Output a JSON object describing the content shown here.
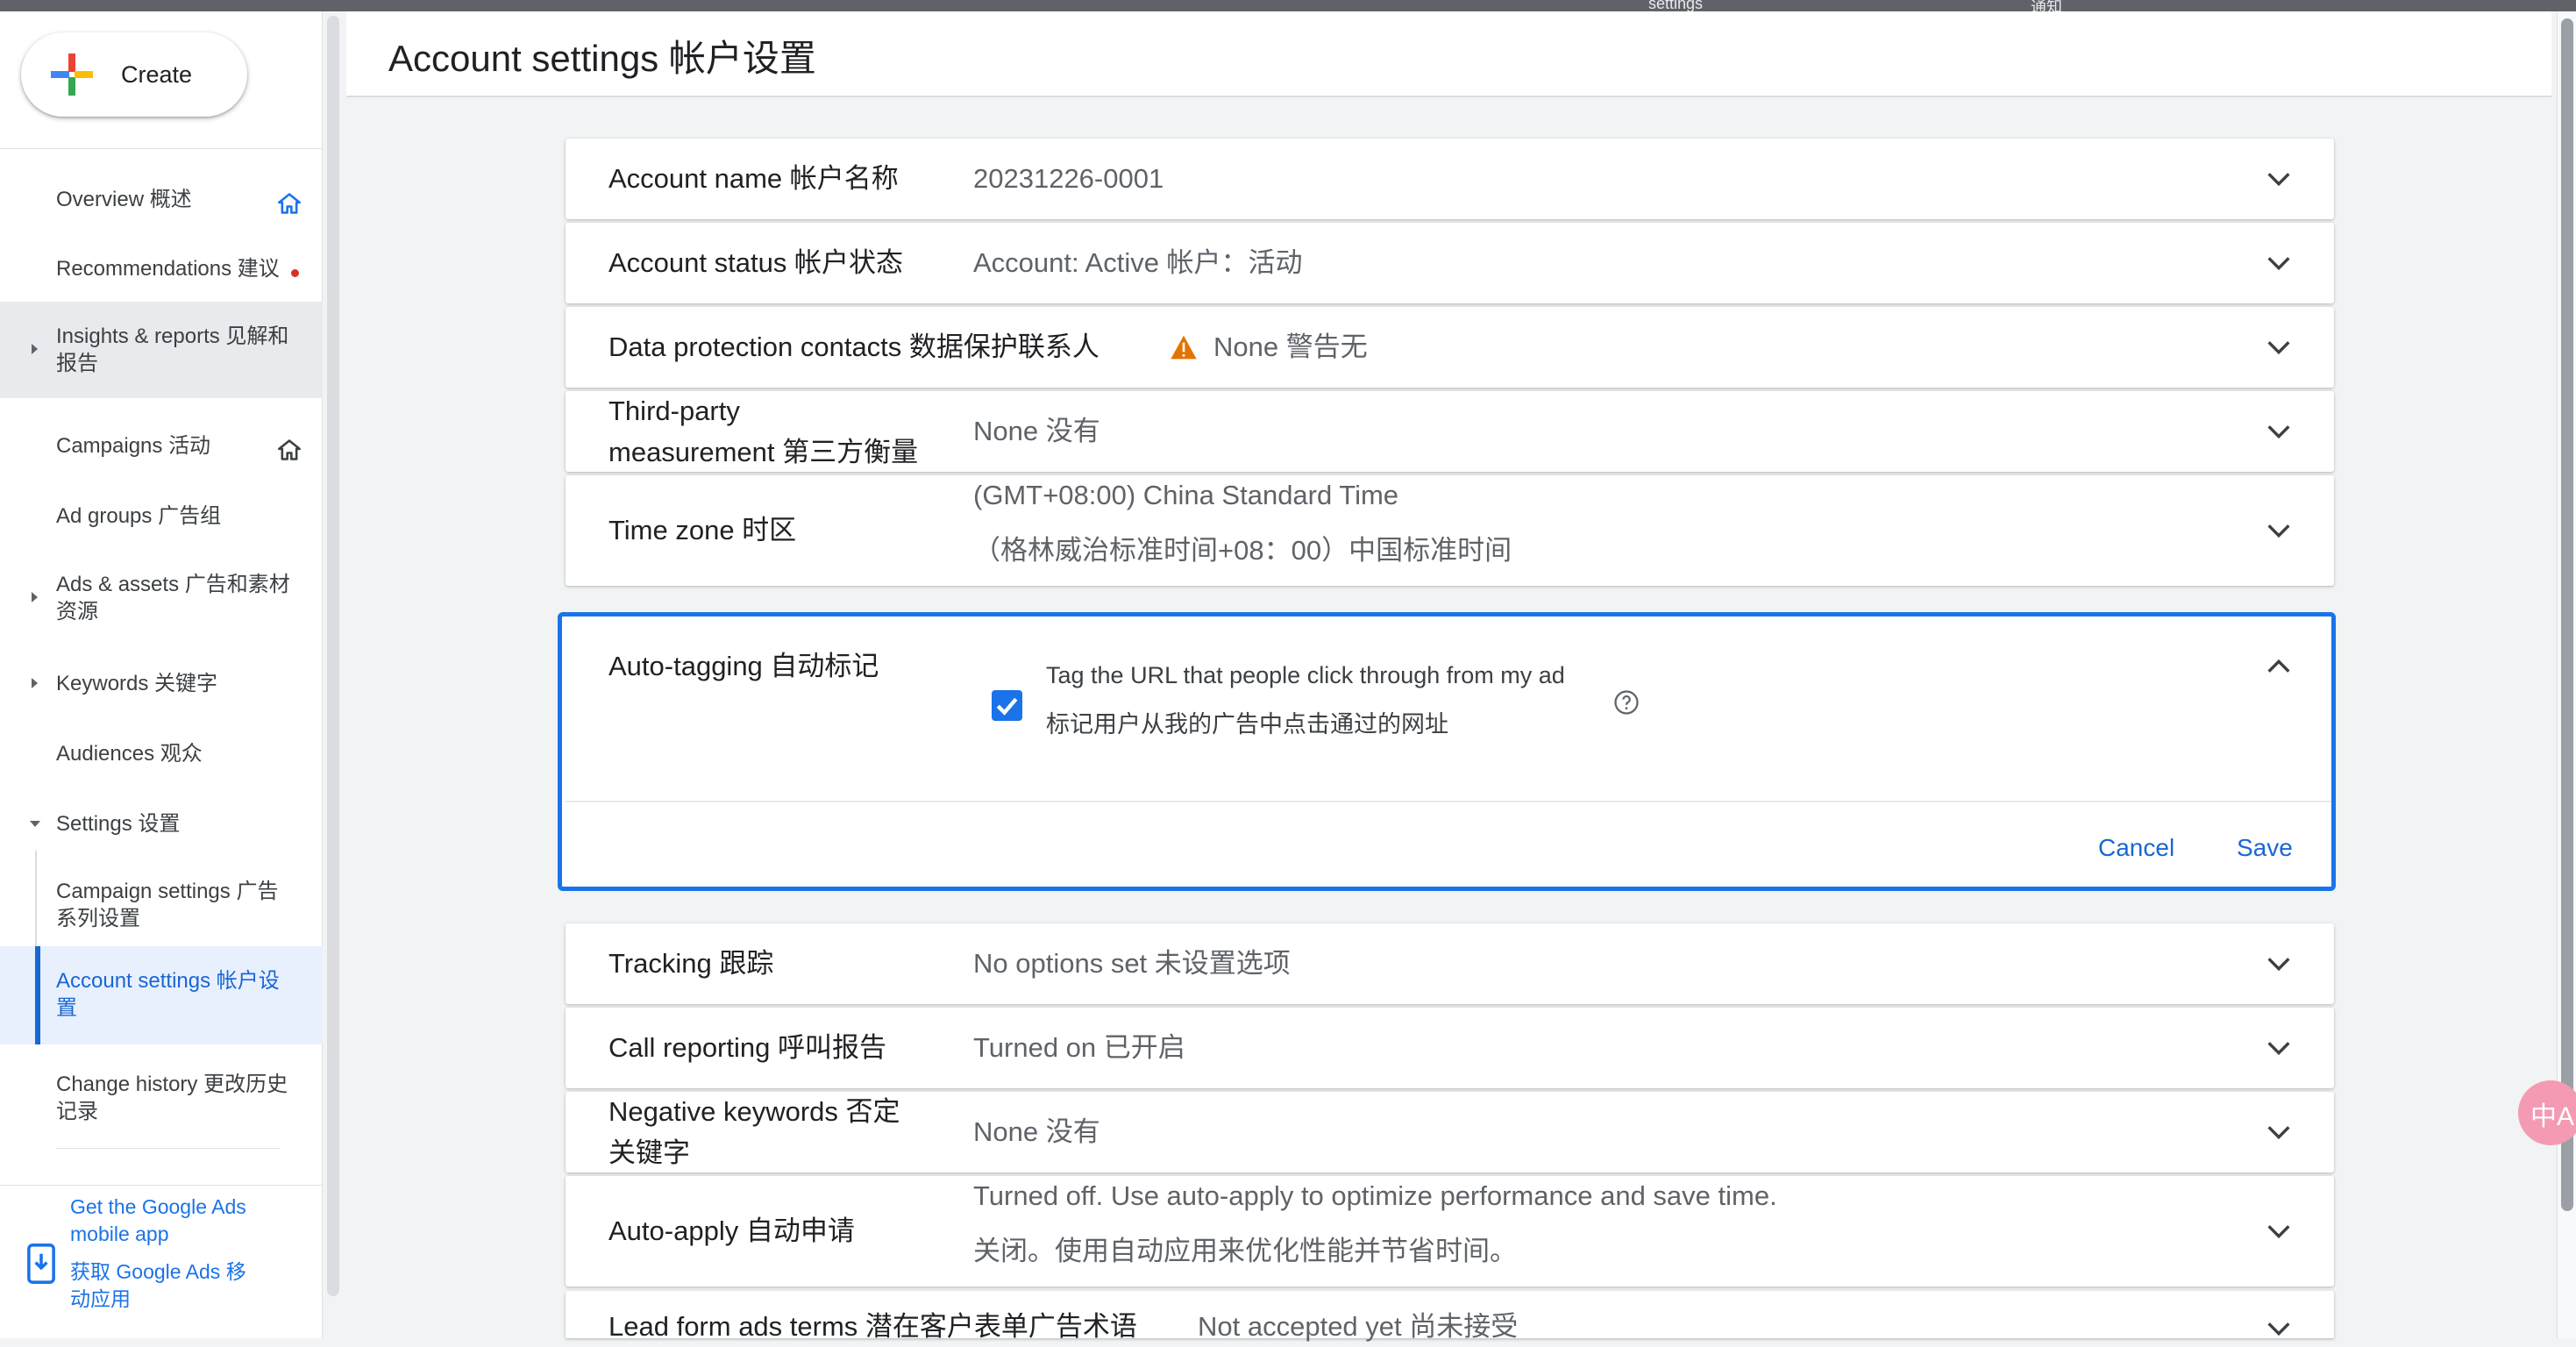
{
  "top_strip": {
    "left_text": "settings",
    "right_text": "通知"
  },
  "create_button": {
    "label": "Create"
  },
  "sidebar": {
    "items": [
      {
        "label": "Overview 概述"
      },
      {
        "label": "Recommendations 建议"
      },
      {
        "label": "Insights & reports 见解和报告"
      },
      {
        "label": "Campaigns 活动"
      },
      {
        "label": "Ad groups 广告组"
      },
      {
        "label": "Ads & assets 广告和素材资源"
      },
      {
        "label": "Keywords 关键字"
      },
      {
        "label": "Audiences 观众"
      },
      {
        "label": "Settings 设置"
      },
      {
        "label": "Campaign settings 广告系列设置"
      },
      {
        "label": "Account settings 帐户设置"
      },
      {
        "label": "Change history 更改历史记录"
      }
    ],
    "app_link": {
      "en": "Get the Google Ads mobile app",
      "zh": "获取 Google Ads 移动应用"
    }
  },
  "header": {
    "title": "Account settings 帐户设置"
  },
  "settings": {
    "account_name": {
      "label": "Account name 帐户名称",
      "value": "20231226-0001"
    },
    "account_status": {
      "label": "Account status 帐户状态",
      "value": "Account: Active 帐户：活动"
    },
    "data_protection": {
      "label": "Data protection contacts 数据保护联系人",
      "value": "None 警告无"
    },
    "third_party": {
      "label_line1": "Third-party",
      "label_line2": "measurement 第三方衡量",
      "value": "None 没有"
    },
    "time_zone": {
      "label": "Time zone 时区",
      "value_line1": "(GMT+08:00) China Standard Time",
      "value_line2": "（格林威治标准时间+08：00）中国标准时间"
    },
    "auto_tagging": {
      "label": "Auto-tagging 自动标记",
      "checkbox_line1": "Tag the URL that people click through from my ad",
      "checkbox_line2": "标记用户从我的广告中点击通过的网址",
      "checked": true,
      "cancel_label": "Cancel",
      "save_label": "Save"
    },
    "tracking": {
      "label": "Tracking 跟踪",
      "value": "No options set 未设置选项"
    },
    "call_reporting": {
      "label": "Call reporting 呼叫报告",
      "value": "Turned on 已开启"
    },
    "negative_keywords": {
      "label_line1": "Negative keywords 否定",
      "label_line2": "关键字",
      "value": "None 没有"
    },
    "auto_apply": {
      "label": "Auto-apply 自动申请",
      "value_line1": "Turned off. Use auto-apply to optimize performance and save time.",
      "value_line2": "关闭。使用自动应用来优化性能并节省时间。"
    },
    "lead_form": {
      "label": "Lead form ads terms 潜在客户表单广告术语",
      "value": "Not accepted yet 尚未接受"
    }
  },
  "floating_widget": {
    "text": "中A"
  },
  "colors": {
    "accent": "#1a73e8",
    "warning": "#e37400",
    "notification_dot": "#d93025",
    "widget": "#f49ab3"
  },
  "icons": [
    "google-plus-icon",
    "home-icon",
    "notification-dot-icon",
    "warning-icon",
    "chevron-down-icon",
    "chevron-up-icon",
    "checkmark-icon",
    "help-circle-icon",
    "mobile-phone-icon"
  ]
}
